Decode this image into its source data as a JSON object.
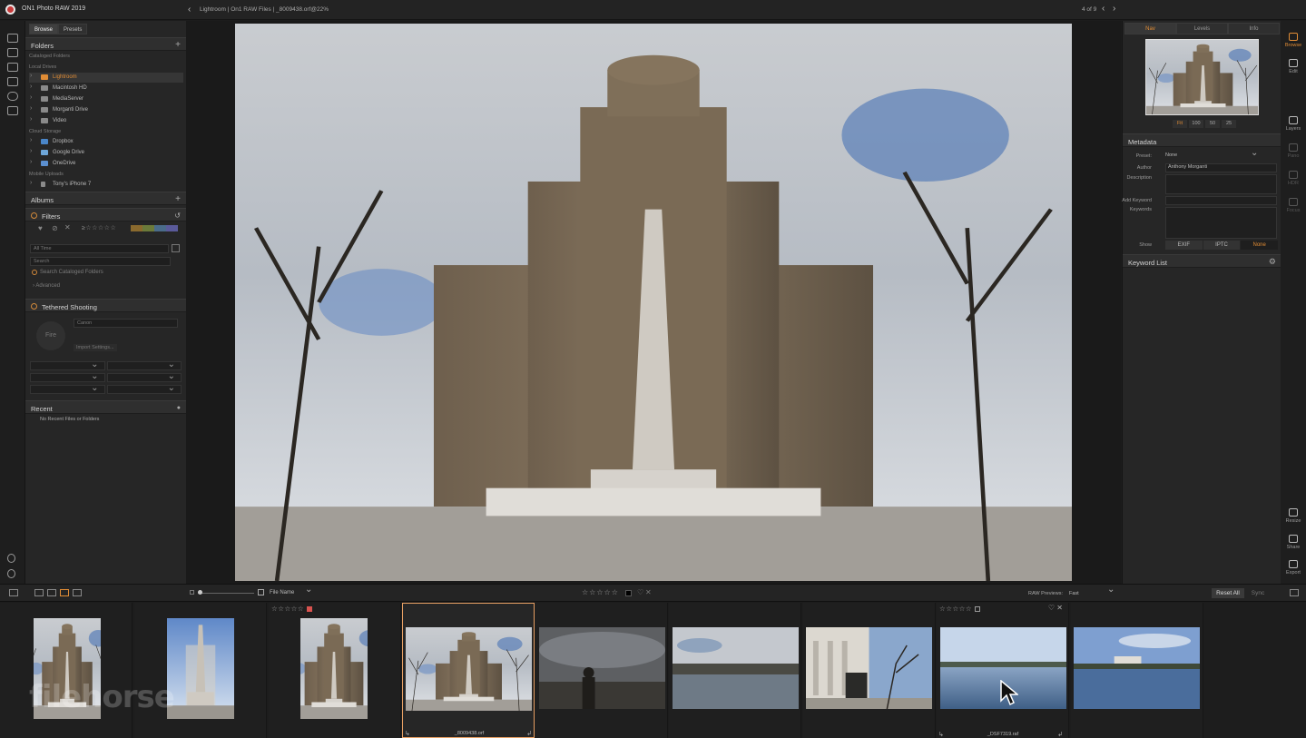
{
  "app": {
    "title": "ON1 Photo RAW 2019"
  },
  "topbar": {
    "breadcrumb": "Lightroom | On1 RAW Files | _8009438.orf@22%",
    "counter": "4 of 9"
  },
  "left_panel": {
    "tabs": [
      "Browse",
      "Presets"
    ],
    "folders": {
      "title": "Folders",
      "groups": {
        "cataloged": "Cataloged Folders",
        "local": "Local Drives",
        "cloud": "Cloud Storage",
        "mobile": "Mobile Uploads"
      },
      "local_items": [
        "Lightroom",
        "Macintosh HD",
        "MediaServer",
        "Morganti Drive",
        "Video"
      ],
      "cloud_items": [
        "Dropbox",
        "Google Drive",
        "OneDrive"
      ],
      "mobile_items": [
        "Tony's iPhone 7"
      ]
    },
    "albums": {
      "title": "Albums"
    },
    "filters": {
      "title": "Filters",
      "time": "All Time",
      "search_placeholder": "Search",
      "search_cataloged": "Search Cataloged Folders",
      "advanced": "Advanced"
    },
    "tethered": {
      "title": "Tethered Shooting",
      "camera": "Canon",
      "fire": "Fire",
      "import": "Import Settings..."
    },
    "recent": {
      "title": "Recent",
      "empty": "No Recent Files or Folders"
    }
  },
  "right_panel": {
    "tabs": [
      "Nav",
      "Levels",
      "Info"
    ],
    "zoom": [
      "Fit",
      "100",
      "50",
      "25"
    ],
    "metadata": {
      "title": "Metadata",
      "preset_label": "Preset:",
      "preset_value": "None",
      "author_label": "Author",
      "author_value": "Anthony Morganti",
      "description_label": "Description",
      "add_keyword_label": "Add Keyword",
      "keywords_label": "Keywords",
      "show_label": "Show",
      "show_options": [
        "EXIF",
        "IPTC",
        "None"
      ]
    },
    "keyword_list": {
      "title": "Keyword List"
    }
  },
  "right_rail": [
    "Browse",
    "Edit",
    "Layers",
    "Pano",
    "HDR",
    "Focus",
    "Resize",
    "Share",
    "Export"
  ],
  "strip_toolbar": {
    "sort": "File Name",
    "stars": "☆☆☆☆☆",
    "raw_label": "RAW Previews:",
    "raw_value": "Fast",
    "reset": "Reset All",
    "sync": "Sync"
  },
  "filmstrip": {
    "watermark": "filehorse",
    "items": [
      {
        "name": "",
        "stars": ""
      },
      {
        "name": "",
        "stars": ""
      },
      {
        "name": "",
        "stars": "☆☆☆☆☆"
      },
      {
        "name": "_8009438.orf",
        "stars": ""
      },
      {
        "name": "",
        "stars": ""
      },
      {
        "name": "",
        "stars": ""
      },
      {
        "name": "",
        "stars": ""
      },
      {
        "name": "_DSF7319.raf",
        "stars": "☆☆☆☆☆"
      },
      {
        "name": "",
        "stars": ""
      }
    ]
  },
  "colors": {
    "accent": "#e08c35",
    "panel": "#262626",
    "selected_border": "#e8a064"
  }
}
